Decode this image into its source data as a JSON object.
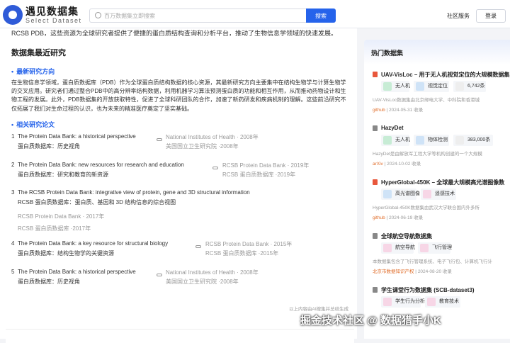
{
  "header": {
    "logo_title": "遇见数据集",
    "logo_subtitle": "Select Dataset",
    "search_placeholder": "百万数据集立即搜索",
    "search_button": "搜索",
    "community_label": "社区服务",
    "login_label": "登录"
  },
  "main": {
    "intro_text": "RCSB PDB，这些资源为全球研究者提供了便捷的蛋白质结构查询和分析平台，推动了生物信息学领域的快速发展。",
    "section_title": "数据集最近研究",
    "research_direction_title": "最新研究方向",
    "research_paragraph": "在生物信息学领域，蛋白质数据库（PDB）作为全球蛋白质结构数据的核心资源，其最新研究方向主要集中在结构生物学与计算生物学的交叉应用。研究者们通过整合PDB中的高分辨率结构数据，利用机器学习算法预测蛋白质的功能和相互作用，从而推动药物设计和生物工程的发展。此外，PDB数据集的开放获取特性，促进了全球科研团队的合作，加速了新药研发和疾病机制的理解。这些前沿研究不仅拓展了我们对生命过程的认识，也为未来的精准医疗奠定了坚实基础。",
    "papers_title": "相关研究论文",
    "papers": [
      {
        "num": "1",
        "title_en": "The Protein Data Bank: a historical perspective",
        "title_cn": "蛋白质数据库：历史视角",
        "meta_en": "National Institutes of Health · 2008年",
        "meta_cn": "美国国立卫生研究院 ·2008年"
      },
      {
        "num": "2",
        "title_en": "The Protein Data Bank: new resources for research and education",
        "title_cn": "蛋白质数据库：研究和教育的新资源",
        "meta_en": "RCSB Protein Data Bank · 2019年",
        "meta_cn": "RCSB 蛋白质数据库 ·2019年"
      },
      {
        "num": "3",
        "title_en": "The RCSB Protein Data Bank: integrative view of protein, gene and 3D structural information",
        "title_cn": "RCSB 蛋白质数据库：蛋白质、基因和 3D 结构信息的综合视图",
        "meta_en": "RCSB Protein Data Bank · 2017年",
        "meta_cn": "RCSB 蛋白质数据库 ·2017年"
      },
      {
        "num": "4",
        "title_en": "The Protein Data Bank: a key resource for structural biology",
        "title_cn": "蛋白质数据库：结构生物学的关键资源",
        "meta_en": "RCSB Protein Data Bank · 2015年",
        "meta_cn": "RCSB 蛋白质数据库 ·2015年"
      },
      {
        "num": "5",
        "title_en": "The Protein Data Bank: a historical perspective",
        "title_cn": "蛋白质数据库：历史视角",
        "meta_en": "National Institutes of Health · 2008年",
        "meta_cn": "美国国立卫生研究院 ·2008年"
      }
    ],
    "footnote": "以上内容由AI搜集并总结生成"
  },
  "sidebar": {
    "title": "热门数据集",
    "datasets": [
      {
        "icon_color": "#e8573c",
        "title": "UAV-VisLoc – 用于无人机视觉定位的大规模数据集",
        "tag1": "无人机",
        "tag2": "视觉定位",
        "count": "6,742条",
        "desc": "UAV-VisLoc数据集由北京邮电大学、中科院和香港城",
        "source": "github",
        "date": "2024-05-31 收录"
      },
      {
        "icon_color": "#888888",
        "title": "HazyDet",
        "tag1": "无人机",
        "tag2": "物体检测",
        "count": "383,000条",
        "desc": "HazyDet是由解放军工程大学等机构创建的一个大规模",
        "source": "arXiv",
        "date": "2024-10-02 收录"
      },
      {
        "icon_color": "#e8573c",
        "title": "HyperGlobal-450K – 全球最大规模高光谱图像数",
        "tag1": "高光谱图像",
        "tag2": "遥感技术",
        "count": "",
        "desc": "HyperGlobal-450K数据集由武汉大学联合国内外多所",
        "source": "github",
        "date": "2024-06-19 收录"
      },
      {
        "icon_color": "#888888",
        "title": "全球航空导航数据集",
        "tag1": "航空导航",
        "tag2": "飞行管理",
        "count": "",
        "desc": "本数据集包含了飞行管理系统、电子飞行包、计算机飞行计",
        "source": "北京市数据知识产权",
        "date": "2024-08-20 收录"
      },
      {
        "icon_color": "#888888",
        "title": "学生课堂行为数据集 (SCB-dataset3)",
        "tag1": "学生行为分析",
        "tag2": "教育技术",
        "count": "",
        "desc": "",
        "source": "",
        "date": ""
      }
    ]
  },
  "watermark": "掘金技术社区 @ 数据猎手小K",
  "colors": {
    "accent": "#2563eb",
    "source": "#e06d2a"
  }
}
